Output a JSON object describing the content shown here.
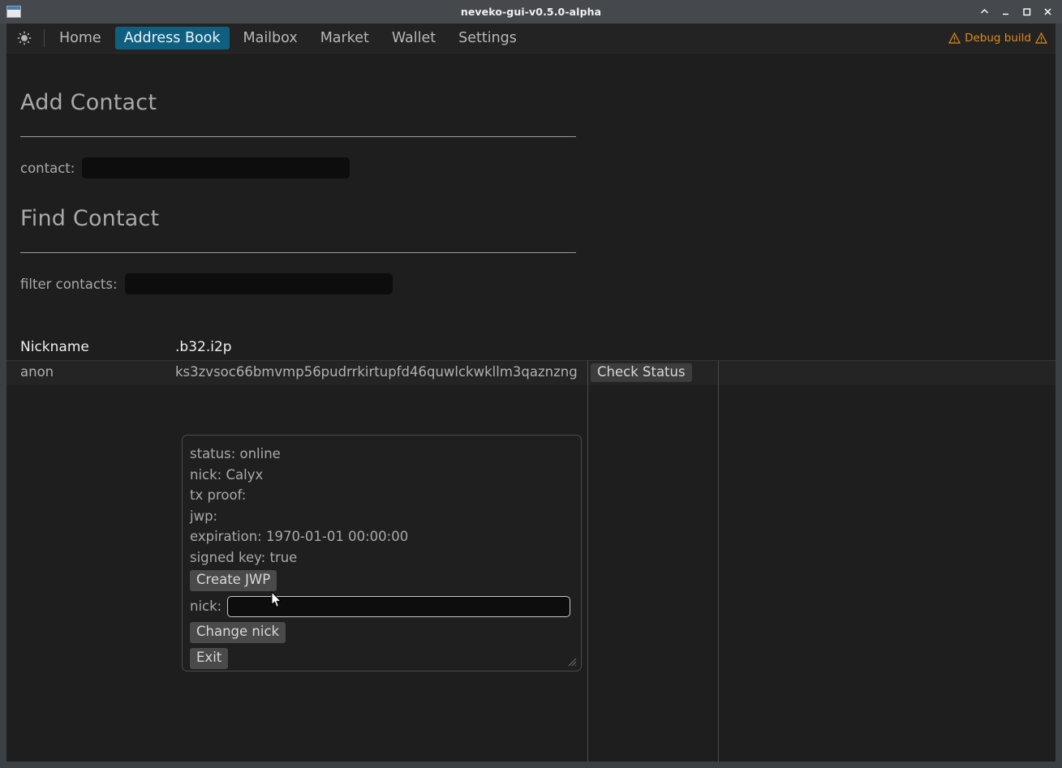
{
  "window": {
    "title": "neveko-gui-v0.5.0-alpha",
    "icon": "window-icon",
    "controls": [
      {
        "name": "shade-button",
        "glyph": "chevron-up-icon"
      },
      {
        "name": "minimize-button",
        "glyph": "minimize-icon"
      },
      {
        "name": "maximize-button",
        "glyph": "maximize-icon"
      },
      {
        "name": "close-button",
        "glyph": "close-icon"
      }
    ]
  },
  "menubar": {
    "theme_icon": "sun-icon",
    "items": [
      {
        "label": "Home",
        "active": false
      },
      {
        "label": "Address Book",
        "active": true
      },
      {
        "label": "Mailbox",
        "active": false
      },
      {
        "label": "Market",
        "active": false
      },
      {
        "label": "Wallet",
        "active": false
      },
      {
        "label": "Settings",
        "active": false
      }
    ],
    "debug": {
      "label": "Debug build",
      "color": "#e08b18",
      "left_icon": "warning-triangle-icon",
      "right_icon": "warning-triangle-icon"
    }
  },
  "add_contact": {
    "heading": "Add Contact",
    "contact_label": "contact:",
    "contact_value": "",
    "contact_placeholder": ""
  },
  "find_contact": {
    "heading": "Find Contact",
    "filter_label": "filter contacts:",
    "filter_value": "",
    "filter_placeholder": ""
  },
  "contacts_table": {
    "columns": [
      "Nickname",
      ".b32.i2p",
      "",
      ""
    ],
    "rows": [
      {
        "nickname": "anon",
        "b32_i2p": "ks3zvsoc66bmvmp56pudrrkirtupfd46quwlckwkllm3qaznzng",
        "action_label": "Check Status"
      }
    ]
  },
  "status_popup": {
    "lines": [
      "status: online",
      "nick: Calyx",
      "tx proof:",
      "jwp:",
      "expiration: 1970-01-01 00:00:00",
      "signed key: true"
    ],
    "create_jwp_label": "Create JWP",
    "nick_label": "nick:",
    "nick_value": "",
    "nick_placeholder": "",
    "change_nick_label": "Change nick",
    "exit_label": "Exit",
    "resize_grip": "resize-grip-icon"
  },
  "colors": {
    "accent": "#0f6080",
    "warning": "#e08b18",
    "app_background": "#1e1e1e",
    "frame": "#3b4044"
  }
}
